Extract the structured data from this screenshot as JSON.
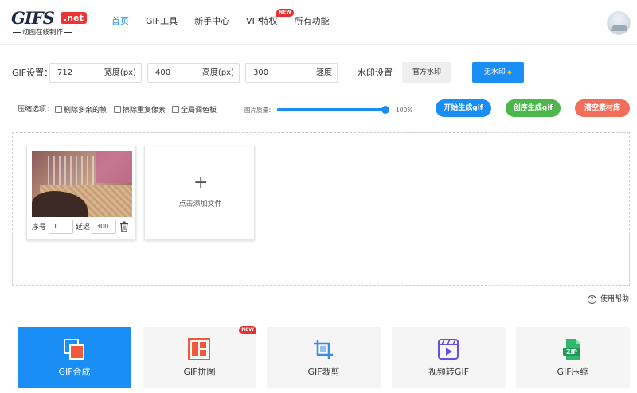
{
  "brand": {
    "logo_text": "GIFS",
    "logo_badge": ".net",
    "tagline": "动图在线制作"
  },
  "nav": {
    "items": [
      {
        "label": "首页",
        "active": true
      },
      {
        "label": "GIF工具"
      },
      {
        "label": "新手中心"
      },
      {
        "label": "VIP特权",
        "badge": "NEW"
      },
      {
        "label": "所有功能"
      }
    ]
  },
  "settings": {
    "gif_label": "GIF设置：",
    "width": {
      "value": "712",
      "unit": "宽度(px)"
    },
    "height": {
      "value": "400",
      "unit": "高度(px)"
    },
    "speed": {
      "value": "300",
      "unit": "速度"
    },
    "watermark_label": "水印设置",
    "official_watermark": "官方水印",
    "no_watermark": "无水印"
  },
  "compression": {
    "label": "压缩选项：",
    "options": [
      "删除多余的帧",
      "擦除重复像素",
      "全局调色板"
    ],
    "quality_label": "图片质量：",
    "quality_value": "100%",
    "quality_fraction": 1.0
  },
  "actions": {
    "start": {
      "label": "开始生成gif",
      "color": "#1a8ef5"
    },
    "create": {
      "label": "创序生成gif",
      "color": "#4cb84c"
    },
    "clear": {
      "label": "清空素材库",
      "color": "#f06e5a"
    }
  },
  "frame": {
    "seq_label": "序号",
    "seq_value": "1",
    "delay_label": "延迟",
    "delay_value": "300"
  },
  "add_file_label": "点击添加文件",
  "help_label": "使用帮助",
  "tools": [
    {
      "label": "GIF合成",
      "icon": "gif-compose-icon",
      "active": true
    },
    {
      "label": "GIF拼图",
      "icon": "gif-collage-icon",
      "badge": "NEW"
    },
    {
      "label": "GIF裁剪",
      "icon": "crop-icon"
    },
    {
      "label": "视频转GIF",
      "icon": "video-to-gif-icon"
    },
    {
      "label": "GIF压缩",
      "icon": "zip-icon"
    }
  ]
}
